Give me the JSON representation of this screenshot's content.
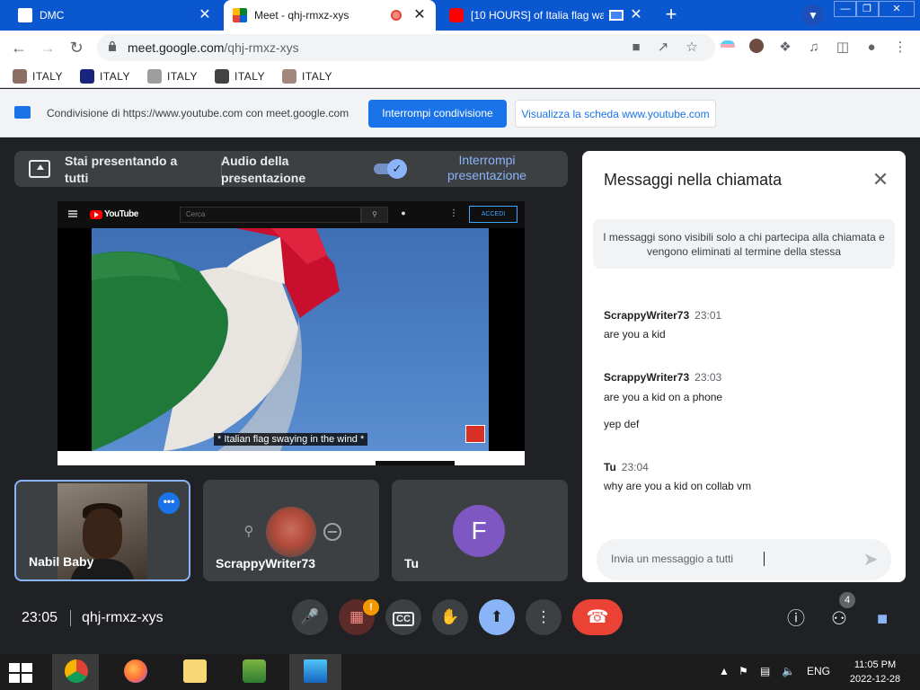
{
  "browser": {
    "tabs": [
      {
        "title": "DMC",
        "close": "✕"
      },
      {
        "title": "Meet - qhj-rmxz-xys",
        "close": "✕"
      },
      {
        "title": "[10 HOURS] of Italia flag wa",
        "close": "✕"
      }
    ],
    "new_tab": "+",
    "url_host": "meet.google.com",
    "url_path": "/qhj-rmxz-xys",
    "bookmarks": [
      "ITALY",
      "ITALY",
      "ITALY",
      "ITALY",
      "ITALY"
    ]
  },
  "infobar": {
    "text": "Condivisione di https://www.youtube.com con meet.google.com",
    "stop_label": "Interrompi condivisione",
    "view_label": "Visualizza la scheda www.youtube.com"
  },
  "presenting": {
    "title": "Stai presentando a tutti",
    "audio_label": "Audio della presentazione",
    "audio_on": true,
    "stop_label": "Interrompi presentazione"
  },
  "shared_video": {
    "logo": "YouTube",
    "search_placeholder": "Cerca",
    "signin": "ACCEDI",
    "caption": "* Italian flag swaying in the wind *"
  },
  "participants": [
    {
      "name": "Nabil Baby",
      "speaking": true
    },
    {
      "name": "ScrappyWriter73",
      "speaking": false
    },
    {
      "name": "Tu",
      "initial": "F",
      "speaking": false
    }
  ],
  "chat": {
    "title": "Messaggi nella chiamata",
    "notice": "I messaggi sono visibili solo a chi partecipa alla chiamata e vengono eliminati al termine della stessa",
    "messages": [
      {
        "author": "ScrappyWriter73",
        "time": "23:01",
        "lines": [
          "are you a kid"
        ]
      },
      {
        "author": "ScrappyWriter73",
        "time": "23:03",
        "lines": [
          "are you a kid on a phone",
          "yep def"
        ]
      },
      {
        "author": "Tu",
        "time": "23:04",
        "lines": [
          "why are you a kid on collab vm"
        ]
      }
    ],
    "input_placeholder": "Invia un messaggio a tutti"
  },
  "controls": {
    "clock": "23:05",
    "meeting_code": "qhj-rmxz-xys",
    "people_count": "4",
    "camera_warning": "!"
  },
  "taskbar": {
    "lang": "ENG",
    "time": "11:05 PM",
    "date": "2022-12-28"
  },
  "colors": {
    "tab_strip": "#0b57d0",
    "meet_bg": "#202124",
    "accent": "#1a73e8",
    "hangup": "#ea4335"
  }
}
